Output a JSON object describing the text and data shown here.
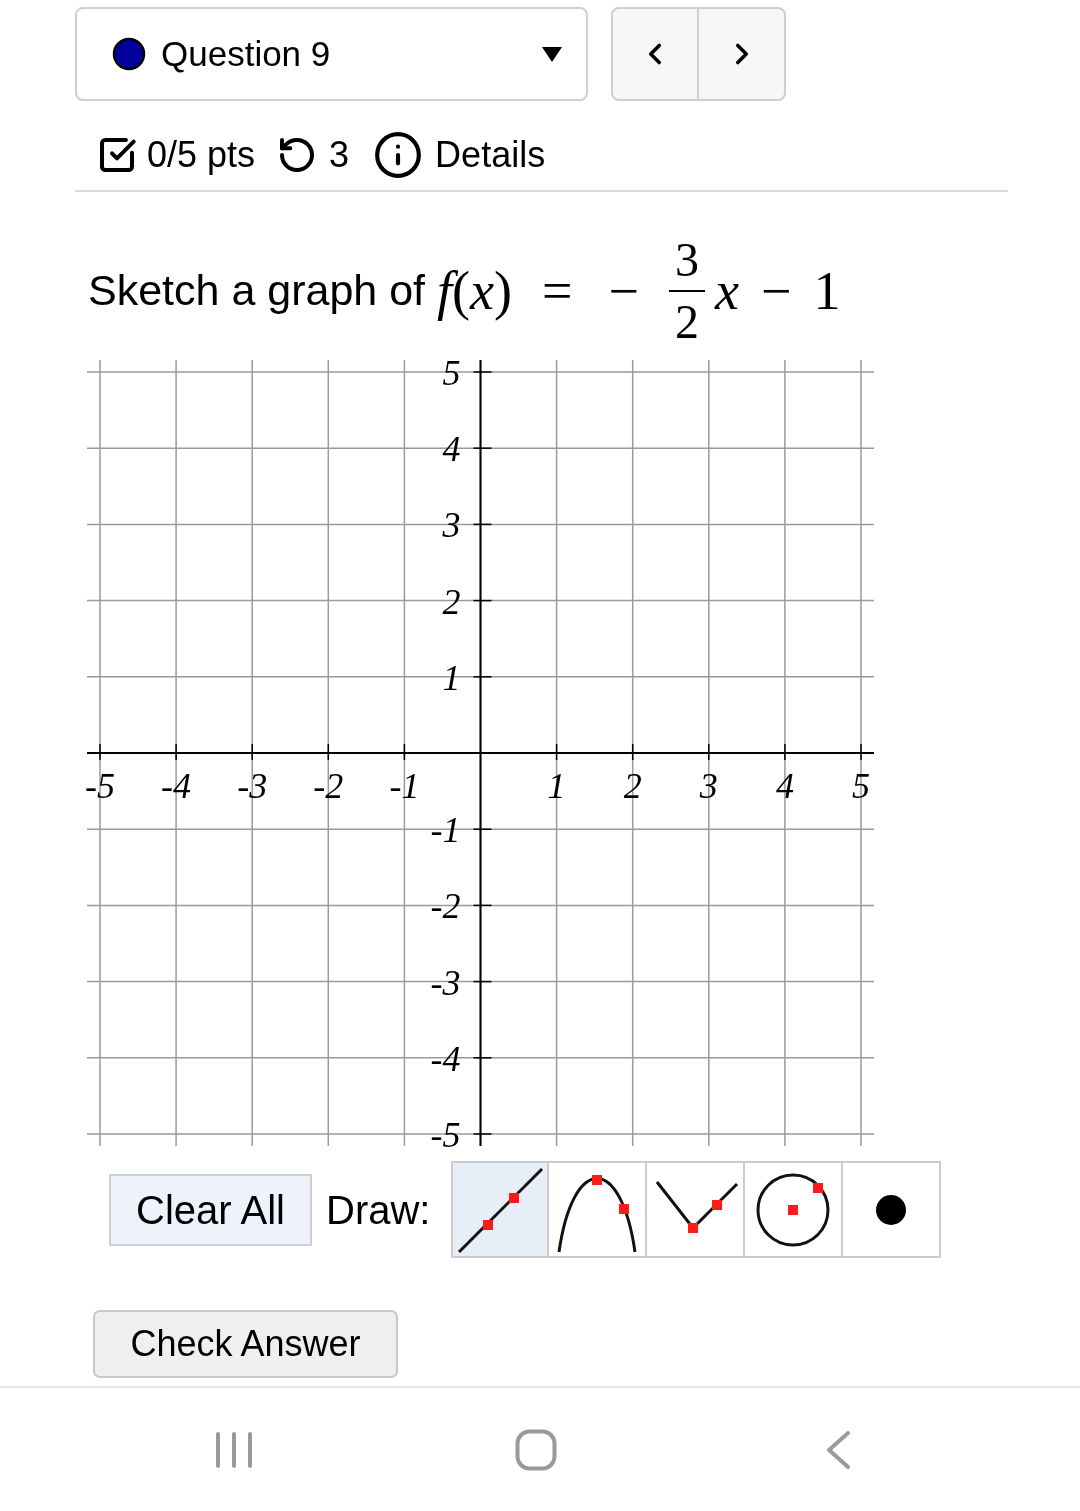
{
  "question_select": {
    "label": "Question 9"
  },
  "score": {
    "points": "0/5 pts",
    "attempts": "3",
    "details": "Details"
  },
  "question": {
    "prompt": "Sketch a graph of",
    "function": "*f*(*x*)",
    "equals": "=",
    "sign": "−",
    "numerator": "3",
    "denominator": "2",
    "variable": "x",
    "operator": "−",
    "constant": "1"
  },
  "graph": {
    "chart_data": {
      "type": "line",
      "grid": true,
      "xlim": [
        -5,
        5
      ],
      "ylim": [
        -5,
        5
      ],
      "xticks": [
        -5,
        -4,
        -3,
        -2,
        -1,
        1,
        2,
        3,
        4,
        5
      ],
      "yticks": [
        -5,
        -4,
        -3,
        -2,
        -1,
        1,
        2,
        3,
        4,
        5
      ]
    }
  },
  "toolbar": {
    "clear_button": "Clear All",
    "draw_label": "Draw:",
    "tools": [
      {
        "kind": "line",
        "selected": true
      },
      {
        "kind": "parabola",
        "selected": false
      },
      {
        "kind": "absolute_value",
        "selected": false
      },
      {
        "kind": "circle",
        "selected": false
      },
      {
        "kind": "point",
        "selected": false
      }
    ]
  },
  "check_button": "Check Answer"
}
